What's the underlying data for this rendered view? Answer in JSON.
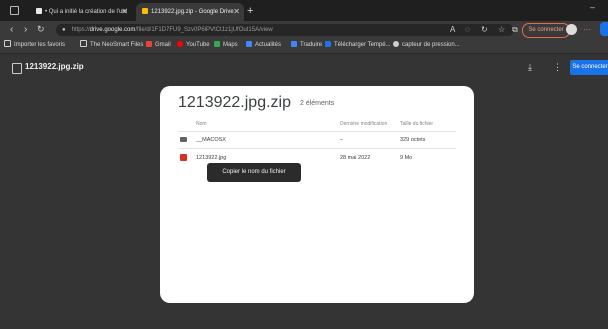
{
  "browser": {
    "tabs": [
      {
        "title": "• Qui a initié la création de l'uni",
        "close": "✕",
        "favicon_color": "#e8e8e8"
      },
      {
        "title": "1213922.jpg.zip - Google Drive",
        "close": "✕",
        "favicon_color": "#fbbc04"
      }
    ],
    "new_tab": "+",
    "url_domain": "drive.google.com",
    "url_prefix": "https://",
    "url_rest": "/file/d/1F1D7FU9_Szv0P6lPVtCt1z1jUfOuI15A/view",
    "connect_label": "Se connecter",
    "bookmarks": [
      {
        "label": "Importer les favoris",
        "color": "#cfcfcf"
      },
      {
        "label": "The NeoSmart Files",
        "color": "#cfcfcf"
      },
      {
        "label": "Gmail",
        "color": "#ea4335"
      },
      {
        "label": "YouTube",
        "color": "#ff0000"
      },
      {
        "label": "Maps",
        "color": "#34a853"
      },
      {
        "label": "Actualités",
        "color": "#4285f4"
      },
      {
        "label": "Traduire",
        "color": "#4285f4"
      },
      {
        "label": "Télécharger Tempé...",
        "color": "#1a73e8"
      },
      {
        "label": "capteur de pression...",
        "color": "#cfcfcf"
      }
    ]
  },
  "drive": {
    "file_title": "1213922.jpg.zip",
    "connect_label": "Se connecter"
  },
  "card": {
    "zip_name": "1213922.jpg.zip",
    "item_count": "2 éléments",
    "columns": [
      "Nom",
      "Dernière modification",
      "Taille du fichier"
    ],
    "rows": [
      {
        "name": "__MACOSX",
        "modified": "–",
        "size": "329 octets",
        "type": "folder"
      },
      {
        "name": "1213922.jpg",
        "modified": "28 mai 2022",
        "size": "9 Mo",
        "type": "image"
      }
    ]
  },
  "tooltip": "Copier le nom du fichier"
}
